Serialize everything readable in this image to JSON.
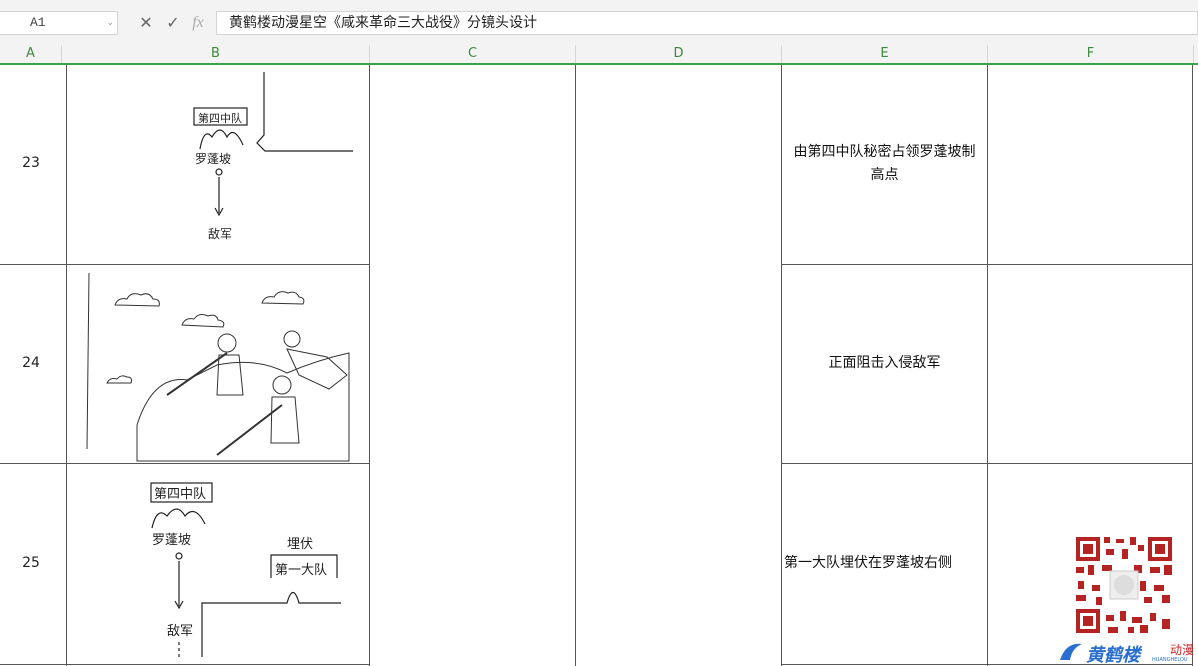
{
  "formula_bar": {
    "name_box": "A1",
    "cancel_glyph": "✕",
    "confirm_glyph": "✓",
    "fx_label": "fx",
    "content": "黄鹤楼动漫星空《咸来革命三大战役》分镜头设计"
  },
  "columns": [
    "A",
    "B",
    "C",
    "D",
    "E",
    "F"
  ],
  "rows": [
    {
      "number": "23",
      "sketch": {
        "squad_label": "第四中队",
        "hill_label": "罗蓬坡",
        "enemy_label": "敌军"
      },
      "description": [
        "由第四中队秘密占领罗蓬坡制",
        "高点"
      ]
    },
    {
      "number": "24",
      "sketch": {
        "scene": "soldiers firing from the hill"
      },
      "description": [
        "正面阻击入侵敌军"
      ]
    },
    {
      "number": "25",
      "sketch": {
        "squad_label": "第四中队",
        "hill_label": "罗蓬坡",
        "enemy_label": "敌军",
        "ambush_label": "埋伏",
        "battalion_label": "第一大队"
      },
      "description": [
        "第一大队埋伏在罗蓬坡右侧"
      ]
    }
  ],
  "watermark": {
    "logo_text": "黄鹤楼",
    "brand_text": "动漫",
    "sub_text": "HUANGHELOU"
  },
  "colors": {
    "header_green": "#3aa04a",
    "grid_line": "#555555",
    "logo_blue": "#2a6fd0",
    "logo_red": "#d0282a"
  },
  "icons": [
    "cancel-icon",
    "confirm-icon",
    "function-icon",
    "dropdown-icon",
    "qr-code-icon",
    "logo-icon"
  ]
}
